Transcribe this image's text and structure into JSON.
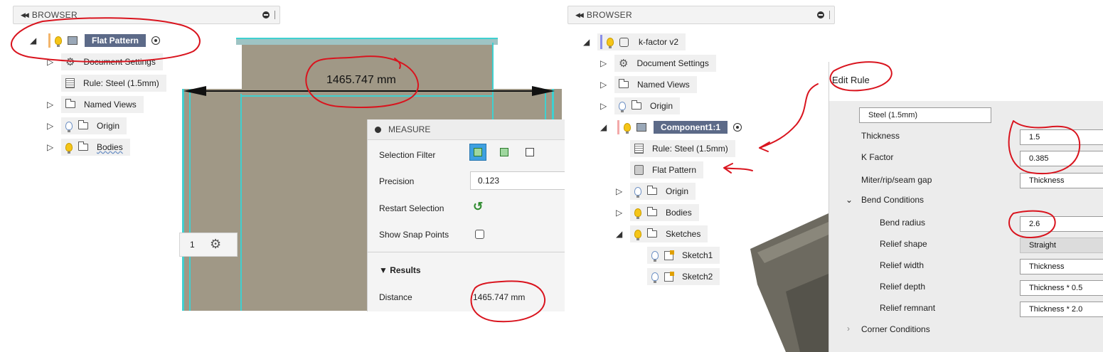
{
  "left_browser": {
    "header": "BROWSER",
    "items": [
      {
        "label": "Flat Pattern"
      },
      {
        "label": "Document Settings"
      },
      {
        "label": "Rule: Steel (1.5mm)"
      },
      {
        "label": "Named Views"
      },
      {
        "label": "Origin"
      },
      {
        "label": "Bodies"
      }
    ]
  },
  "viewport_left": {
    "dimension_label": "1465.747 mm",
    "view_number": "1"
  },
  "measure": {
    "title": "MEASURE",
    "selection_filter_label": "Selection Filter",
    "precision_label": "Precision",
    "precision_value": "0.123",
    "restart_label": "Restart Selection",
    "snap_label": "Show Snap Points",
    "results_label": "Results",
    "distance_label": "Distance",
    "distance_value": "1465.747 mm"
  },
  "right_browser": {
    "header": "BROWSER",
    "items": [
      {
        "label": "k-factor v2"
      },
      {
        "label": "Document Settings"
      },
      {
        "label": "Named Views"
      },
      {
        "label": "Origin"
      },
      {
        "label": "Component1:1"
      },
      {
        "label": "Rule: Steel (1.5mm)"
      },
      {
        "label": "Flat Pattern"
      },
      {
        "label": "Origin"
      },
      {
        "label": "Bodies"
      },
      {
        "label": "Sketches"
      },
      {
        "label": "Sketch1"
      },
      {
        "label": "Sketch2"
      }
    ]
  },
  "edit_rule": {
    "title": "Edit Rule",
    "name_value": "Steel (1.5mm)",
    "thickness_label": "Thickness",
    "thickness_value": "1.5",
    "kfactor_label": "K Factor",
    "kfactor_value": "0.385",
    "miter_label": "Miter/rip/seam gap",
    "miter_value": "Thickness",
    "bend_conditions_label": "Bend Conditions",
    "bend_radius_label": "Bend radius",
    "bend_radius_value": "2.6",
    "relief_shape_label": "Relief shape",
    "relief_shape_value": "Straight",
    "relief_width_label": "Relief width",
    "relief_width_value": "Thickness",
    "relief_depth_label": "Relief depth",
    "relief_depth_value": "Thickness * 0.5",
    "relief_remnant_label": "Relief remnant",
    "relief_remnant_value": "Thickness * 2.0",
    "corner_conditions_label": "Corner Conditions"
  },
  "colors": {
    "annotation": "#d9141e",
    "selection": "#5c6a88",
    "sheet": "#a09886",
    "edge": "#3fd0d0",
    "active_button": "#3ea0e0"
  }
}
